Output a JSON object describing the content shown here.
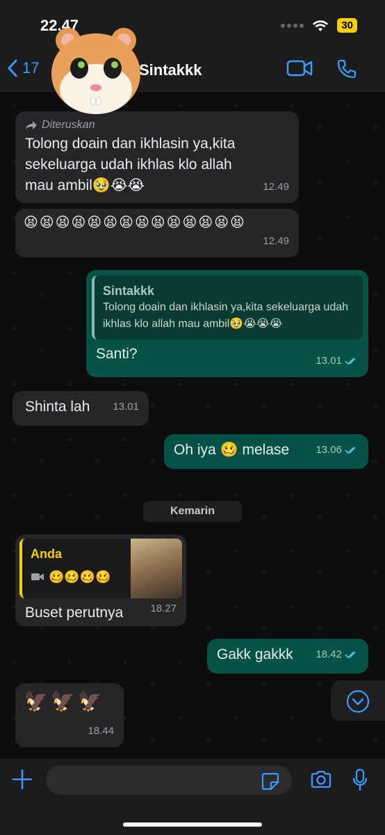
{
  "status_bar": {
    "time": "22.47",
    "battery": "30"
  },
  "header": {
    "back_count": "17",
    "contact_name": "Sintakkk"
  },
  "messages": [
    {
      "forward_label": "Diteruskan",
      "text": "Tolong doain dan ikhlasin ya,kita sekeluarga udah ikhlas klo allah mau ambil🥹😭😭",
      "time": "12.49"
    },
    {
      "text": "😫😫😫😫😫😫😫😫😫😫😫😫😫😫",
      "time": "12.49"
    },
    {
      "quote_name": "Sintakkk",
      "quote_text": "Tolong doain dan ikhlasin ya,kita sekeluarga udah ikhlas klo allah mau ambil🥹😭😭😭",
      "text": "Santi?",
      "time": "13.01"
    },
    {
      "text": "Shinta lah",
      "time": "13.01"
    },
    {
      "text": "Oh iya 🥴 melase",
      "time": "13.06"
    },
    {
      "quote_name": "Anda",
      "quote_media": "🥴🥴🥴🥴",
      "text": "Buset perutnya",
      "time": "18.27"
    },
    {
      "text": "Gakk gakkk",
      "time": "18.42"
    },
    {
      "text": "🦅🦅🦅",
      "time": "18.44"
    }
  ],
  "date_separator": "Kemarin",
  "input": {
    "placeholder": ""
  },
  "colors": {
    "accent": "#3b9cff",
    "outgoing": "#055346",
    "incoming": "#262628",
    "quote_yellow": "#f5d000"
  },
  "icons": [
    "back-chevron-icon",
    "video-call-icon",
    "phone-icon",
    "forward-arrow-icon",
    "read-ticks-icon",
    "video-icon",
    "scroll-down-icon",
    "plus-icon",
    "sticker-icon",
    "camera-icon",
    "mic-icon"
  ]
}
